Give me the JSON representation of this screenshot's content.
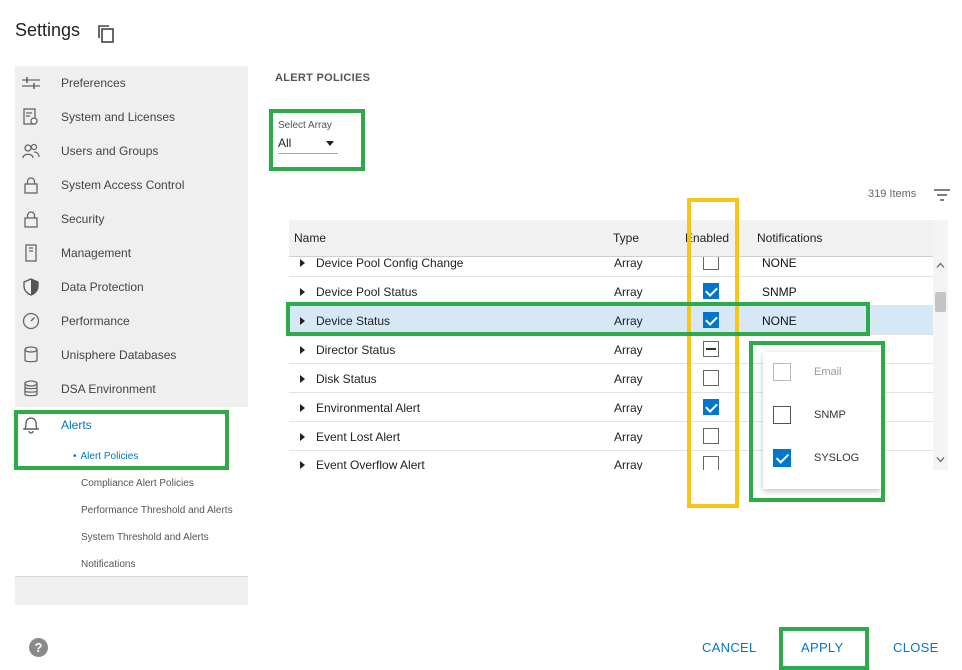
{
  "header": {
    "title": "Settings",
    "copy_icon": "copy-icon"
  },
  "sidebar": {
    "items": [
      {
        "label": "Preferences",
        "icon": "sliders-icon"
      },
      {
        "label": "System and Licenses",
        "icon": "license-icon"
      },
      {
        "label": "Users and Groups",
        "icon": "users-icon"
      },
      {
        "label": "System Access Control",
        "icon": "lock-icon"
      },
      {
        "label": "Security",
        "icon": "lock-icon"
      },
      {
        "label": "Management",
        "icon": "server-icon"
      },
      {
        "label": "Data Protection",
        "icon": "shield-icon"
      },
      {
        "label": "Performance",
        "icon": "gauge-icon"
      },
      {
        "label": "Unisphere Databases",
        "icon": "database-icon"
      },
      {
        "label": "DSA Environment",
        "icon": "database-stack-icon"
      },
      {
        "label": "Alerts",
        "icon": "bell-icon"
      }
    ],
    "sub_items": [
      {
        "label": "Alert Policies",
        "active": true
      },
      {
        "label": "Compliance Alert Policies"
      },
      {
        "label": "Performance Threshold and Alerts"
      },
      {
        "label": "System Threshold and Alerts"
      },
      {
        "label": "Notifications"
      }
    ]
  },
  "main": {
    "section_title": "ALERT POLICIES",
    "select_array": {
      "label": "Select Array",
      "value": "All"
    },
    "items_count": "319 Items",
    "table": {
      "headers": {
        "name": "Name",
        "type": "Type",
        "enabled": "Enabled",
        "notifications": "Notifications"
      },
      "rows": [
        {
          "name": "Device Pool Config Change",
          "type": "Array",
          "enabled": "unchecked",
          "notifications": "NONE"
        },
        {
          "name": "Device Pool Status",
          "type": "Array",
          "enabled": "checked",
          "notifications": "SNMP"
        },
        {
          "name": "Device Status",
          "type": "Array",
          "enabled": "checked",
          "notifications": "NONE",
          "selected": true
        },
        {
          "name": "Director Status",
          "type": "Array",
          "enabled": "indeterminate",
          "notifications": ""
        },
        {
          "name": "Disk Status",
          "type": "Array",
          "enabled": "unchecked",
          "notifications": ""
        },
        {
          "name": "Environmental Alert",
          "type": "Array",
          "enabled": "checked",
          "notifications": ""
        },
        {
          "name": "Event Lost Alert",
          "type": "Array",
          "enabled": "unchecked",
          "notifications": ""
        },
        {
          "name": "Event Overflow Alert",
          "type": "Array",
          "enabled": "unchecked",
          "notifications": ""
        }
      ]
    },
    "notification_dropdown": [
      {
        "label": "Email",
        "state": "disabled"
      },
      {
        "label": "SNMP",
        "state": "unchecked"
      },
      {
        "label": "SYSLOG",
        "state": "checked"
      }
    ]
  },
  "footer": {
    "cancel": "CANCEL",
    "apply": "APPLY",
    "close": "CLOSE",
    "help": "?"
  },
  "colors": {
    "accent": "#0076ce",
    "highlight_green": "#2eaa4a",
    "highlight_yellow": "#f5c518",
    "selected_row": "#d6e8f5"
  }
}
